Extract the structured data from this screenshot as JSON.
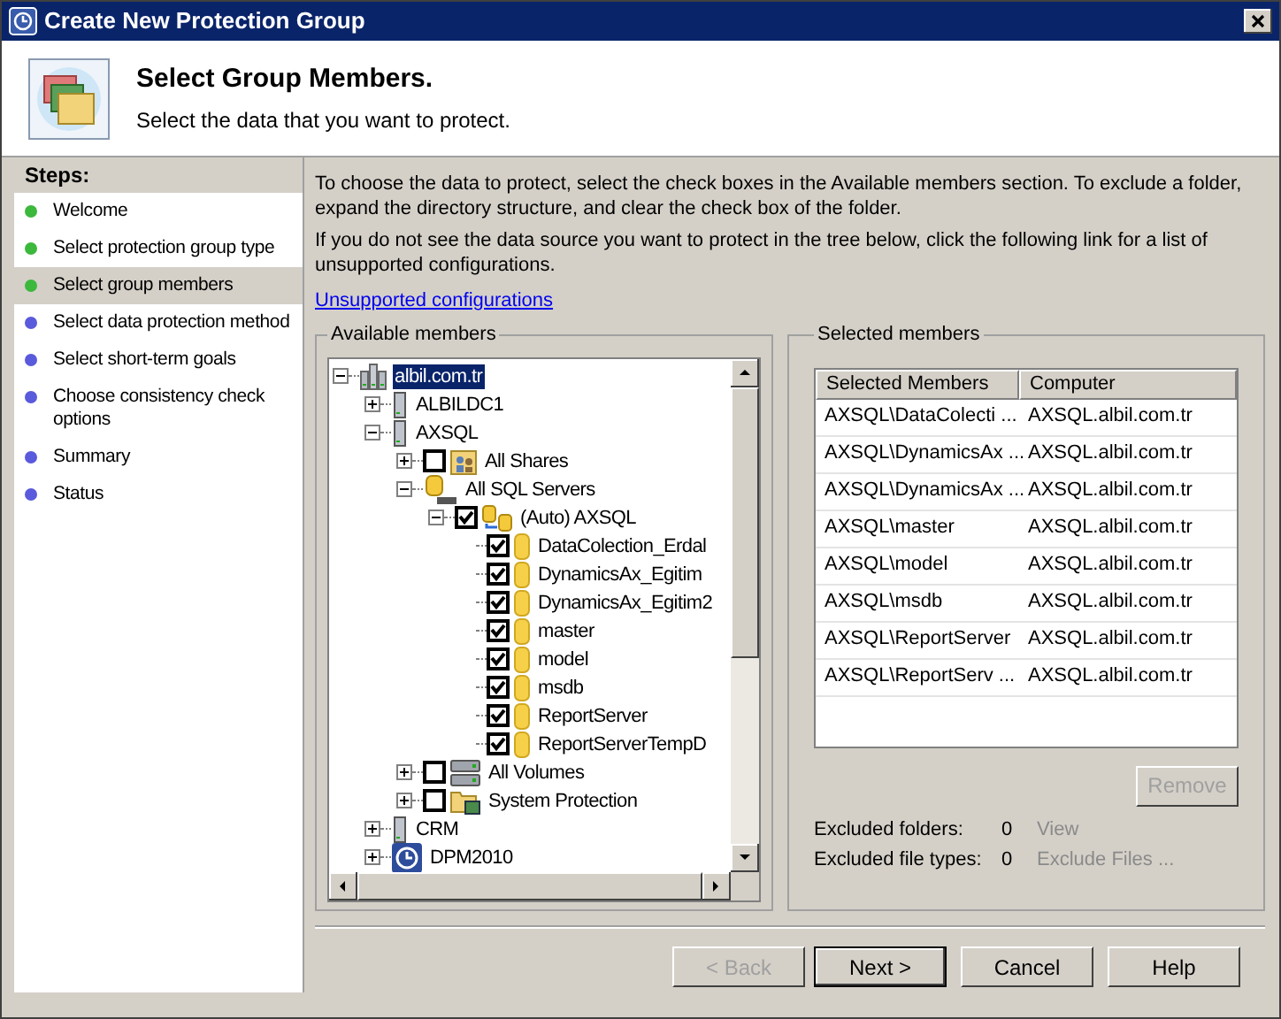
{
  "window": {
    "title": "Create New Protection Group"
  },
  "header": {
    "title": "Select Group Members.",
    "subtitle": "Select the data that you want to protect."
  },
  "steps": {
    "title": "Steps:",
    "items": [
      {
        "label": "Welcome",
        "color": "#3cb83c",
        "selected": false
      },
      {
        "label": "Select protection group type",
        "color": "#3cb83c",
        "selected": false
      },
      {
        "label": "Select group members",
        "color": "#3cb83c",
        "selected": true
      },
      {
        "label": "Select data protection method",
        "color": "#5a5adc",
        "selected": false
      },
      {
        "label": "Select short-term goals",
        "color": "#5a5adc",
        "selected": false
      },
      {
        "label": "Choose consistency check options",
        "color": "#5a5adc",
        "selected": false
      },
      {
        "label": "Summary",
        "color": "#5a5adc",
        "selected": false
      },
      {
        "label": "Status",
        "color": "#5a5adc",
        "selected": false
      }
    ]
  },
  "instructions": [
    "To choose the data to protect, select the check boxes in the Available members section. To exclude a folder, expand the directory structure, and clear the check box of the folder.",
    "If you do not see the data source you want to protect in the tree below, click the following link for a list of unsupported configurations."
  ],
  "link": "Unsupported configurations",
  "available_members": {
    "title": "Available members",
    "tree": [
      {
        "label": "albil.com.tr",
        "kind": "domain",
        "expanded": true,
        "selected": true,
        "children": [
          {
            "label": "ALBILDC1",
            "kind": "server",
            "expanded": false,
            "selected": false
          },
          {
            "label": "AXSQL",
            "kind": "server",
            "expanded": true,
            "selected": false,
            "children": [
              {
                "label": "All Shares",
                "kind": "shares",
                "expanded": false,
                "checked": false,
                "selected": false
              },
              {
                "label": "All SQL Servers",
                "kind": "sql",
                "expanded": true,
                "selected": false,
                "children": [
                  {
                    "label": "(Auto) AXSQL",
                    "kind": "instance",
                    "expanded": true,
                    "checked": true,
                    "selected": false,
                    "children": [
                      {
                        "label": "DataColection_Erdal",
                        "kind": "database",
                        "checked": true,
                        "selected": false
                      },
                      {
                        "label": "DynamicsAx_Egitim",
                        "kind": "database",
                        "checked": true,
                        "selected": false
                      },
                      {
                        "label": "DynamicsAx_Egitim2",
                        "kind": "database",
                        "checked": true,
                        "selected": false
                      },
                      {
                        "label": "master",
                        "kind": "database",
                        "checked": true,
                        "selected": false
                      },
                      {
                        "label": "model",
                        "kind": "database",
                        "checked": true,
                        "selected": false
                      },
                      {
                        "label": "msdb",
                        "kind": "database",
                        "checked": true,
                        "selected": false
                      },
                      {
                        "label": "ReportServer",
                        "kind": "database",
                        "checked": true,
                        "selected": false
                      },
                      {
                        "label": "ReportServerTempD",
                        "kind": "database",
                        "checked": true,
                        "selected": false
                      }
                    ]
                  }
                ]
              },
              {
                "label": "All Volumes",
                "kind": "volumes",
                "expanded": false,
                "checked": false,
                "selected": false
              },
              {
                "label": "System Protection",
                "kind": "system",
                "expanded": false,
                "checked": false,
                "selected": false
              }
            ]
          },
          {
            "label": "CRM",
            "kind": "server",
            "expanded": false,
            "selected": false
          },
          {
            "label": "DPM2010",
            "kind": "dpm",
            "expanded": false,
            "selected": false
          }
        ]
      }
    ]
  },
  "selected_members": {
    "title": "Selected members",
    "columns": [
      "Selected Members",
      "Computer"
    ],
    "rows": [
      [
        "AXSQL\\DataColecti ...",
        "AXSQL.albil.com.tr"
      ],
      [
        "AXSQL\\DynamicsAx ...",
        "AXSQL.albil.com.tr"
      ],
      [
        "AXSQL\\DynamicsAx ...",
        "AXSQL.albil.com.tr"
      ],
      [
        "AXSQL\\master",
        "AXSQL.albil.com.tr"
      ],
      [
        "AXSQL\\model",
        "AXSQL.albil.com.tr"
      ],
      [
        "AXSQL\\msdb",
        "AXSQL.albil.com.tr"
      ],
      [
        "AXSQL\\ReportServer",
        "AXSQL.albil.com.tr"
      ],
      [
        "AXSQL\\ReportServ ...",
        "AXSQL.albil.com.tr"
      ]
    ],
    "remove_button": {
      "label": "Remove",
      "disabled": true
    },
    "excluded": [
      {
        "label": "Excluded folders:",
        "count": "0",
        "action": "View",
        "disabled": true
      },
      {
        "label": "Excluded file types:",
        "count": "0",
        "action": "Exclude Files ...",
        "disabled": true
      }
    ]
  },
  "buttons": [
    {
      "label": "< Back",
      "disabled": true,
      "default": false
    },
    {
      "label": "Next >",
      "disabled": false,
      "default": true
    },
    {
      "label": "Cancel",
      "disabled": false,
      "default": false
    },
    {
      "label": "Help",
      "disabled": false,
      "default": false
    }
  ]
}
